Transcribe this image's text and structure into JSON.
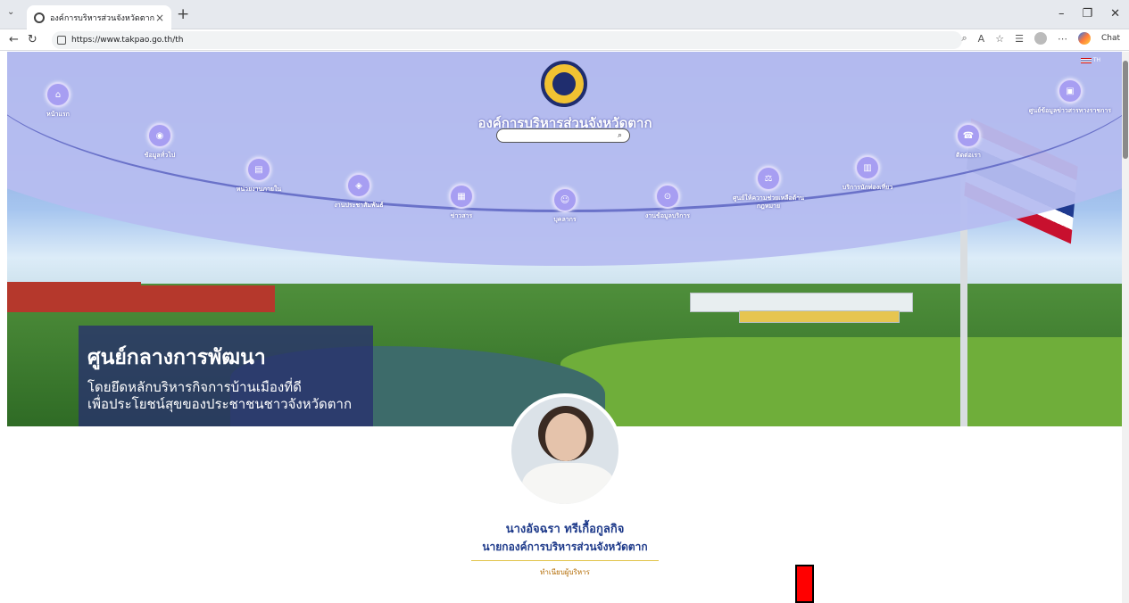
{
  "browser": {
    "tab_title": "องค์การบริหารส่วนจังหวัดตาก",
    "tab_close": "×",
    "new_tab": "+",
    "url": "https://www.takpao.go.th/th",
    "chat_label": "Chat"
  },
  "site": {
    "org_name": "องค์การบริหารส่วนจังหวัดตาก",
    "language": "TH",
    "menu": [
      {
        "label": "หน้าแรก"
      },
      {
        "label": "ข้อมูลทั่วไป"
      },
      {
        "label": "หน่วยงานภายใน"
      },
      {
        "label": "งานประชาสัมพันธ์"
      },
      {
        "label": "ข่าวสาร"
      },
      {
        "label": "บุคลากร"
      },
      {
        "label": "งานข้อมูลบริการ"
      },
      {
        "label": "ศูนย์ให้ความช่วยเหลือด้านกฎหมาย"
      },
      {
        "label": "บริการนักท่องเที่ยว"
      },
      {
        "label": "ติดต่อเรา"
      },
      {
        "label": "ศูนย์ข้อมูลข่าวสารทางราชการ"
      }
    ],
    "hero": {
      "headline": "ศูนย์กลางการพัฒนา",
      "line1": "โดยยึดหลักบริหารกิจการบ้านเมืองที่ดี",
      "line2": "เพื่อประโยชน์สุขของประชาชนชาวจังหวัดตาก"
    },
    "executive": {
      "name": "นางอัจฉรา ทรีเกื้อกูลกิจ",
      "position": "นายกองค์การบริหารส่วนจังหวัดตาก",
      "link": "ทำเนียบผู้บริหาร"
    }
  },
  "colors": {
    "accent": "#1e3a8a",
    "banner": "#b6bdf0",
    "highlight": "#ff0000"
  }
}
